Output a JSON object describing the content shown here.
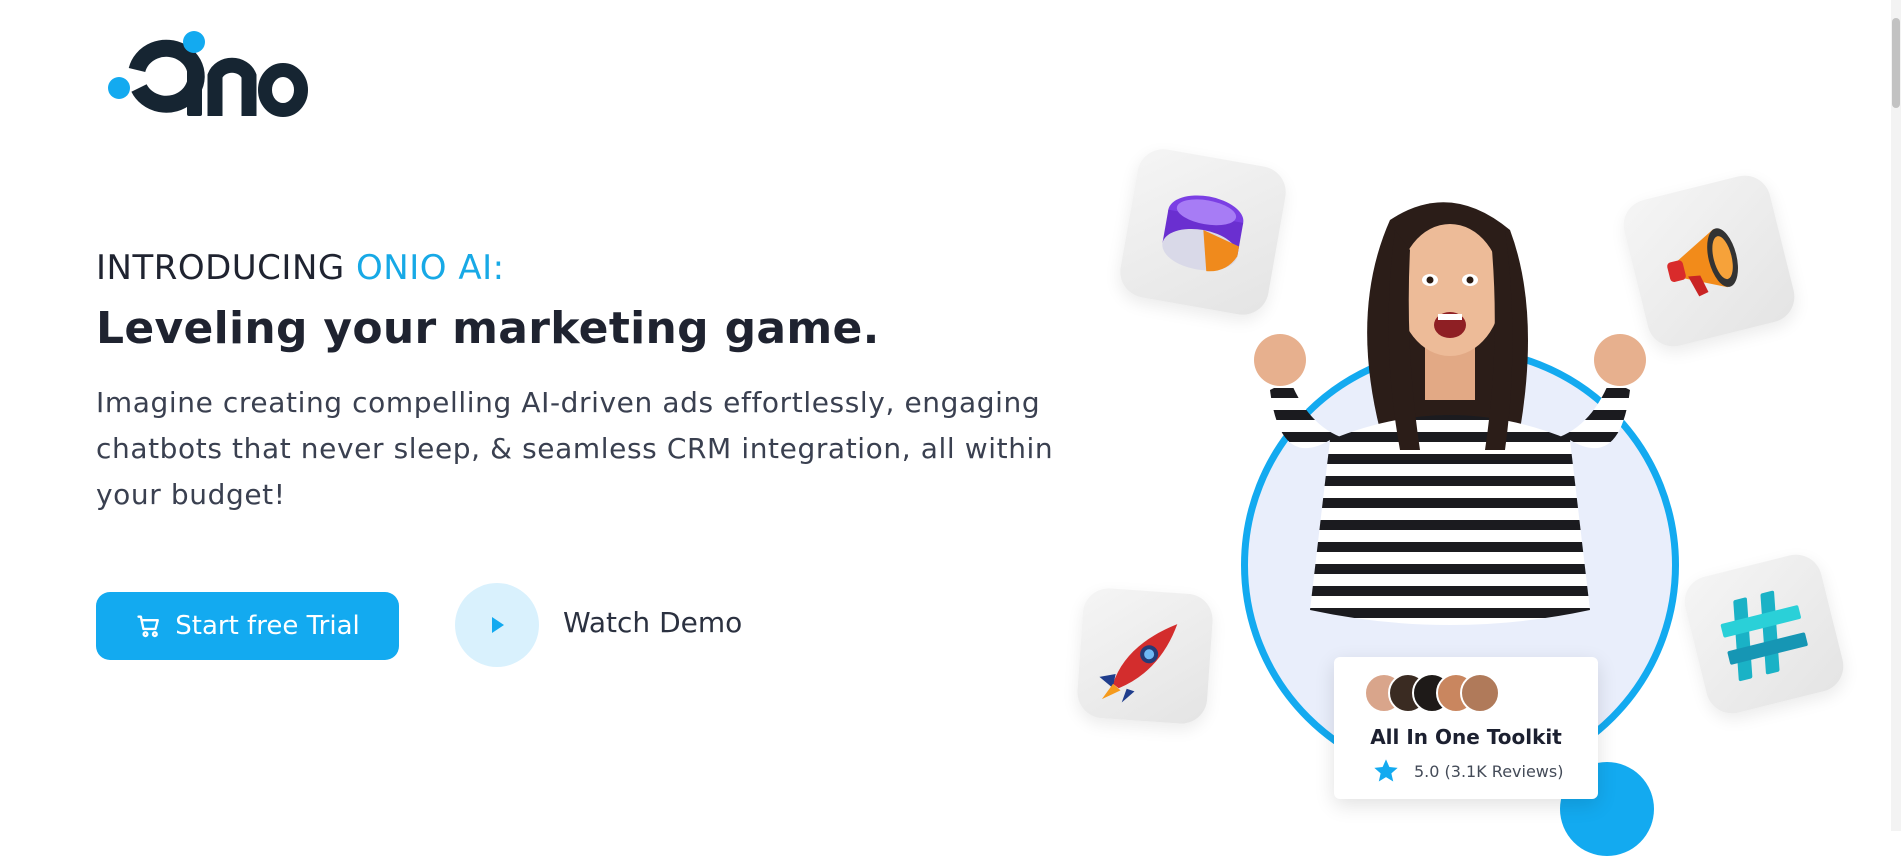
{
  "brand": {
    "name": "Onio",
    "accent": "#13aaf0",
    "dark": "#162532"
  },
  "hero": {
    "intro_prefix": "INTRODUCING ",
    "intro_accent": "ONIO AI:",
    "headline": "Leveling your marketing game.",
    "description": "Imagine creating compelling AI-driven ads effortlessly, engaging chatbots that never sleep, & seamless CRM integration, all within your budget!",
    "cta_trial": "Start free Trial",
    "cta_demo": "Watch Demo"
  },
  "toolkit_card": {
    "title": "All In One Toolkit",
    "rating": "5.0 (3.1K Reviews)"
  },
  "icons": [
    "logo",
    "cart-icon",
    "play-icon",
    "cylinder-icon",
    "megaphone-icon",
    "rocket-icon",
    "hashtag-icon",
    "star-icon"
  ]
}
